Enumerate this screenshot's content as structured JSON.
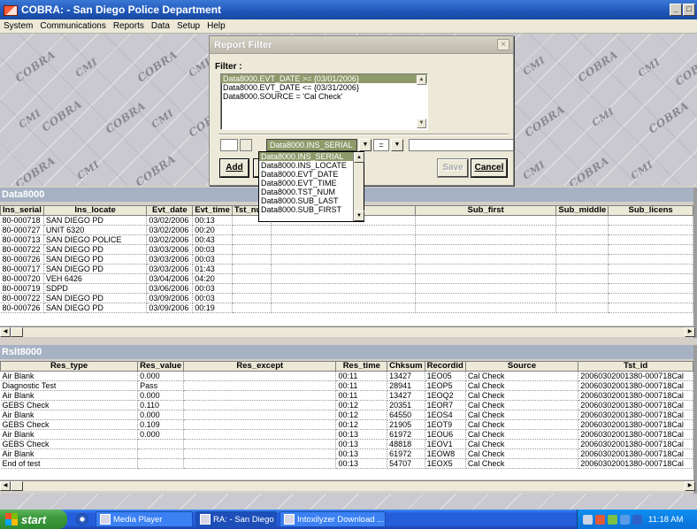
{
  "window": {
    "title": "COBRA: - San Diego Police Department",
    "buttons": [
      "_",
      "□"
    ]
  },
  "menu": [
    "System",
    "Communications",
    "Reports",
    "Data",
    "Setup",
    "Help"
  ],
  "wallpaper": {
    "words": [
      "COBRA",
      "CMI"
    ]
  },
  "dialog": {
    "title": "Report Filter",
    "close_glyph": "×",
    "filter_label": "Filter :",
    "filters": [
      "Data8000.EVT_DATE >= {03/01/2006}",
      "Data8000.EVT_DATE <= {03/31/2006}",
      "Data8000.SOURCE = 'Cal Check'"
    ],
    "field_value": "Data8000.INS_SERIAL",
    "operator": "=",
    "buttons": {
      "add": "Add",
      "save": "Save",
      "cancel": "Cancel"
    },
    "dropdown_options": [
      "Data8000.INS_SERIAL",
      "Data8000.INS_LOCATE",
      "Data8000.EVT_DATE",
      "Data8000.EVT_TIME",
      "Data8000.TST_NUM",
      "Data8000.SUB_LAST",
      "Data8000.SUB_FIRST"
    ]
  },
  "data_grid": {
    "title": "Data8000",
    "columns": [
      "Ins_serial",
      "Ins_locate",
      "Evt_date",
      "Evt_time",
      "Tst_num",
      "",
      "Sub_first",
      "Sub_middle",
      "Sub_licens"
    ],
    "rows": [
      [
        "80-000718",
        "SAN DIEGO PD",
        "03/02/2006",
        "00:13"
      ],
      [
        "80-000727",
        "UNIT 6320",
        "03/02/2006",
        "00:20"
      ],
      [
        "80-000713",
        "SAN DIEGO POLICE",
        "03/02/2006",
        "00:43"
      ],
      [
        "80-000722",
        "SAN DIEGO PD",
        "03/03/2006",
        "00:03"
      ],
      [
        "80-000726",
        "SAN DIEGO PD",
        "03/03/2006",
        "00:03"
      ],
      [
        "80-000717",
        "SAN DIEGO PD",
        "03/03/2006",
        "01:43"
      ],
      [
        "80-000720",
        "VEH 6426",
        "03/04/2006",
        "04:20"
      ],
      [
        "80-000719",
        "SDPD",
        "03/06/2006",
        "00:03"
      ],
      [
        "80-000722",
        "SAN DIEGO PD",
        "03/09/2006",
        "00:03"
      ],
      [
        "80-000726",
        "SAN DIEGO PD",
        "03/09/2006",
        "00:19"
      ]
    ]
  },
  "result_grid": {
    "title": "Rslt8000",
    "columns": [
      "Res_type",
      "Res_value",
      "Res_except",
      "Res_time",
      "Chksum",
      "Recordid",
      "Source",
      "Tst_id"
    ],
    "rows": [
      [
        "Air Blank",
        "0.000",
        "",
        "00:11",
        "13427",
        "1EO05",
        "Cal Check",
        "20060302001380-000718Cal"
      ],
      [
        "Diagnostic Test",
        "Pass",
        "",
        "00:11",
        "28941",
        "1EOP5",
        "Cal Check",
        "20060302001380-000718Cal"
      ],
      [
        "Air Blank",
        "0.000",
        "",
        "00:11",
        "13427",
        "1EOQ2",
        "Cal Check",
        "20060302001380-000718Cal"
      ],
      [
        "GEBS Check",
        "0.110",
        "",
        "00:12",
        "20351",
        "1EOR7",
        "Cal Check",
        "20060302001380-000718Cal"
      ],
      [
        "Air Blank",
        "0.000",
        "",
        "00:12",
        "64550",
        "1EOS4",
        "Cal Check",
        "20060302001380-000718Cal"
      ],
      [
        "GEBS Check",
        "0.109",
        "",
        "00:12",
        "21905",
        "1EOT9",
        "Cal Check",
        "20060302001380-000718Cal"
      ],
      [
        "Air Blank",
        "0.000",
        "",
        "00:13",
        "61972",
        "1EOU6",
        "Cal Check",
        "20060302001380-000718Cal"
      ],
      [
        "GEBS Check",
        "",
        "",
        "00:13",
        "48818",
        "1EOV1",
        "Cal Check",
        "20060302001380-000718Cal"
      ],
      [
        "Air Blank",
        "",
        "",
        "00:13",
        "61972",
        "1EOW8",
        "Cal Check",
        "20060302001380-000718Cal"
      ],
      [
        "End of test",
        "",
        "",
        "00:13",
        "54707",
        "1EOX5",
        "Cal Check",
        "20060302001380-000718Cal"
      ]
    ]
  },
  "taskbar": {
    "start": "start",
    "tasks": [
      "Media Player",
      "RA: - San Diego ...",
      "Intoxilyzer Download ..."
    ],
    "clock": "11:18 AM"
  },
  "colors": {
    "selection": "#8f9a6b",
    "panel_bar": "#a6b2c4",
    "titlebar": "#1f56b8"
  }
}
